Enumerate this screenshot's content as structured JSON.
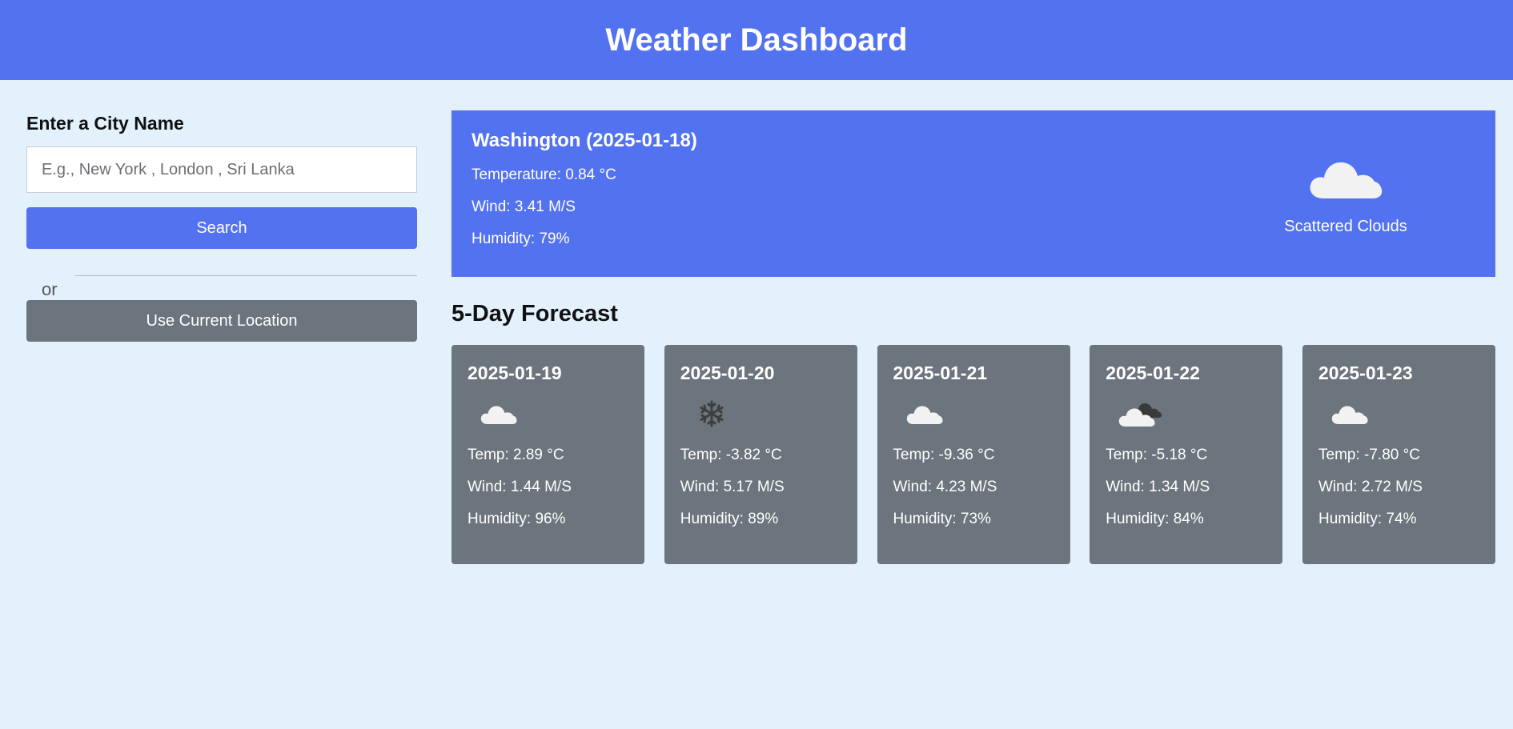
{
  "header": {
    "title": "Weather Dashboard"
  },
  "sidebar": {
    "label": "Enter a City Name",
    "search_placeholder": "E.g., New York , London , Sri Lanka",
    "search_value": "",
    "search_button": "Search",
    "or_text": "or",
    "location_button": "Use Current Location"
  },
  "current": {
    "heading": "Washington (2025-01-18)",
    "temperature": "Temperature: 0.84 °C",
    "wind": "Wind: 3.41 M/S",
    "humidity": "Humidity: 79%",
    "icon": "cloud-icon",
    "description": "Scattered Clouds"
  },
  "forecast": {
    "title": "5-Day Forecast",
    "days": [
      {
        "date": "2025-01-19",
        "icon": "cloud-icon",
        "temp": "Temp: 2.89 °C",
        "wind": "Wind: 1.44 M/S",
        "humidity": "Humidity: 96%"
      },
      {
        "date": "2025-01-20",
        "icon": "snowflake-icon",
        "temp": "Temp: -3.82 °C",
        "wind": "Wind: 5.17 M/S",
        "humidity": "Humidity: 89%"
      },
      {
        "date": "2025-01-21",
        "icon": "cloud-icon",
        "temp": "Temp: -9.36 °C",
        "wind": "Wind: 4.23 M/S",
        "humidity": "Humidity: 73%"
      },
      {
        "date": "2025-01-22",
        "icon": "broken-clouds-icon",
        "temp": "Temp: -5.18 °C",
        "wind": "Wind: 1.34 M/S",
        "humidity": "Humidity: 84%"
      },
      {
        "date": "2025-01-23",
        "icon": "cloud-icon",
        "temp": "Temp: -7.80 °C",
        "wind": "Wind: 2.72 M/S",
        "humidity": "Humidity: 74%"
      }
    ]
  },
  "colors": {
    "accent": "#5372f0",
    "card_bg": "#6c757d",
    "page_bg": "#e3f1fc"
  }
}
